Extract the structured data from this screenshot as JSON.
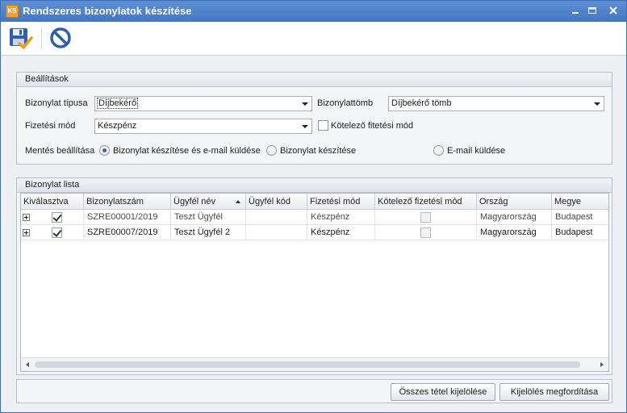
{
  "window": {
    "title": "Rendszeres bizonylatok készítése",
    "app_icon_text": "KS"
  },
  "toolbar": {
    "save_icon": "save-with-check-icon",
    "cancel_icon": "cancel-icon"
  },
  "settings": {
    "header": "Beállítások",
    "doc_type_label": "Bizonylat típusa",
    "doc_type_value": "Díjbekérő",
    "doc_block_label": "Bizonylattömb",
    "doc_block_value": "Díjbekérő tömb",
    "payment_label": "Fizetési mód",
    "payment_value": "Készpénz",
    "mandatory_payment_label": "Kötelező fitetési mód",
    "mandatory_payment_checked": false,
    "save_setting_label": "Mentés beállítása",
    "radio_options": [
      {
        "label": "Bizonylat készítése és e-mail küldése",
        "selected": true
      },
      {
        "label": "Bizonylat készítése",
        "selected": false
      },
      {
        "label": "E-mail küldése",
        "selected": false
      }
    ]
  },
  "list": {
    "header": "Bizonylat lista",
    "columns": [
      "Kiválasztva",
      "Bizonylatszám",
      "Ügyfél név",
      "Ügyfél kód",
      "Fizetési mód",
      "Kötelező fizetési mód",
      "Ország",
      "Megye"
    ],
    "sorted_column": "Ügyfél név",
    "rows": [
      {
        "selected": true,
        "number": "SZRE00001/2019",
        "client_name": "Teszt Ügyfél",
        "client_code": "",
        "payment": "Készpénz",
        "mandatory": false,
        "country": "Magyarország",
        "county": "Budapest"
      },
      {
        "selected": true,
        "number": "SZRE00007/2019",
        "client_name": "Teszt Ügyfél 2",
        "client_code": "",
        "payment": "Készpénz",
        "mandatory": false,
        "country": "Magyarország",
        "county": "Budapest"
      }
    ]
  },
  "footer": {
    "select_all_label": "Összes tétel kijelölése",
    "invert_label": "Kijelölés megfordítása"
  },
  "colors": {
    "titlebar": "#4a7cc4",
    "accent": "#2f66c4"
  }
}
